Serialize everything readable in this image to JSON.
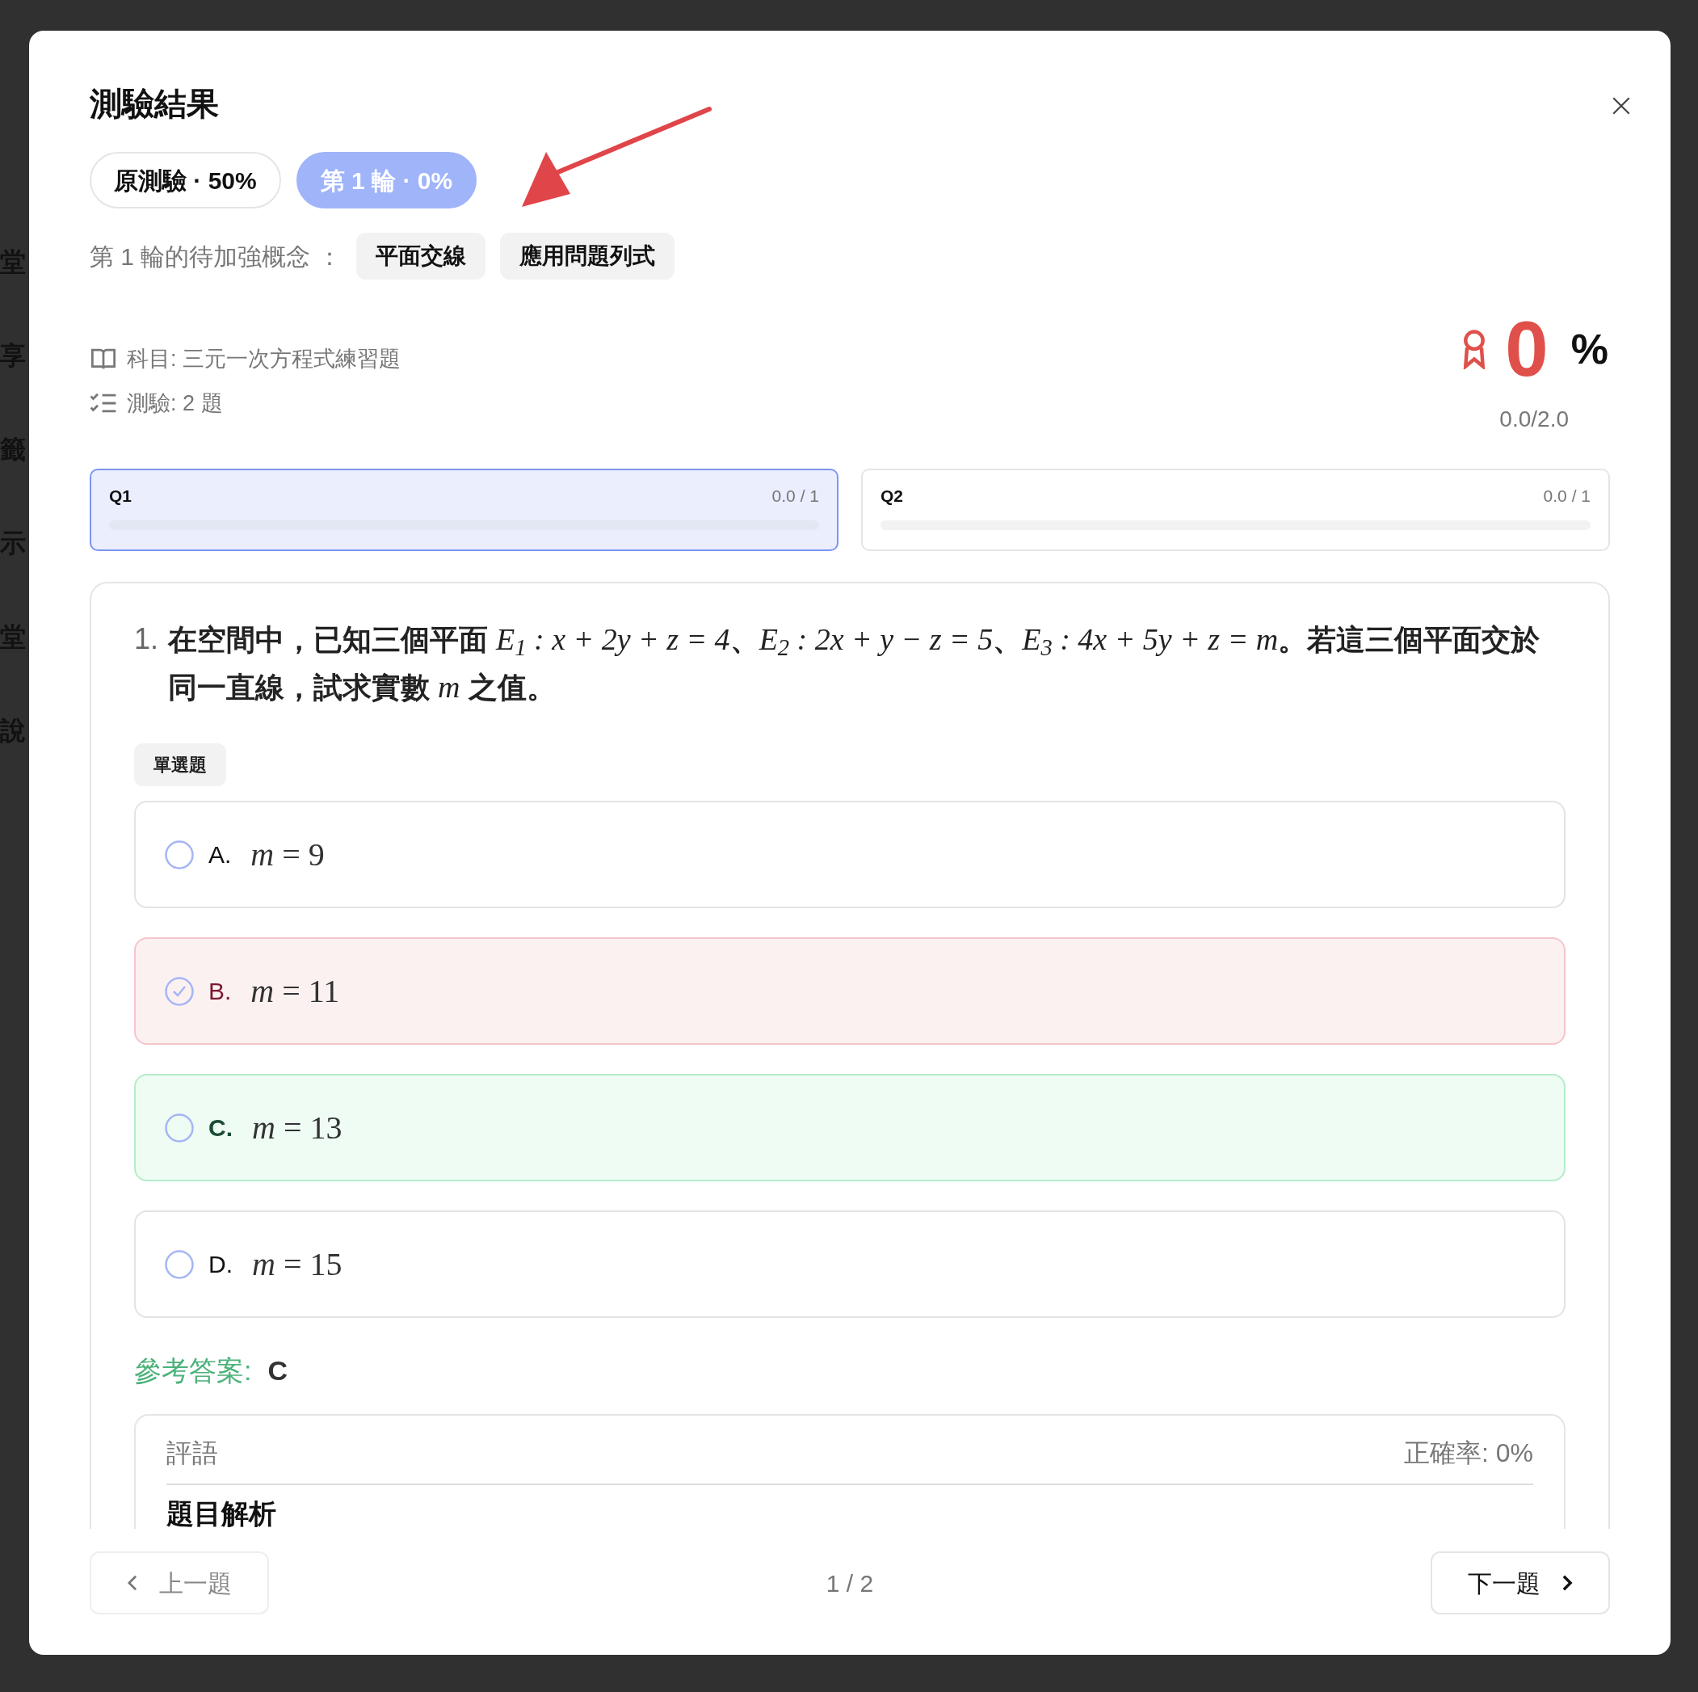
{
  "background_sidebar": [
    "堂",
    "享",
    "籤",
    "示",
    "堂",
    "說"
  ],
  "dialog": {
    "title": "測驗結果",
    "rounds": [
      {
        "label": "原測驗 · 50%",
        "selected": false
      },
      {
        "label": "第 1 輪 · 0%",
        "selected": true
      }
    ],
    "concepts_label": "第 1 輪的待加強概念 ：",
    "concepts": [
      "平面交線",
      "應用問題列式"
    ],
    "subject": "科目: 三元一次方程式練習題",
    "quiz": "測驗: 2 題",
    "score": {
      "value": "0",
      "unit": "%",
      "points": "0.0/2.0"
    },
    "questions": [
      {
        "label": "Q1",
        "score": "0.0 / 1",
        "level": 0,
        "selected": true
      },
      {
        "label": "Q2",
        "score": "0.0 / 1",
        "level": 0,
        "selected": false
      }
    ],
    "question": {
      "number": "1.",
      "text": [
        {
          "kind": "text",
          "text": "在空間中，已知三個平面 "
        },
        {
          "kind": "math",
          "text": "E$_{1}$ : x + 2y + z = 4"
        },
        {
          "kind": "text",
          "text": "、"
        },
        {
          "kind": "math",
          "text": "E$_{2}$ : 2x + y − z = 5"
        },
        {
          "kind": "text",
          "text": "、"
        },
        {
          "kind": "math",
          "text": "E$_{3}$ : 4x + 5y + z = m"
        },
        {
          "kind": "text",
          "text": "。若這三個平面交於同一直線，試求實數 "
        },
        {
          "kind": "math",
          "text": "m"
        },
        {
          "kind": "text",
          "text": " 之值。"
        }
      ],
      "type_tag": "單選題",
      "options": [
        {
          "letter": "A.",
          "value": "*m* = 9",
          "selected": false,
          "kind": "neutral"
        },
        {
          "letter": "B.",
          "value": "*m* = 11",
          "selected": true,
          "kind": "incorrect"
        },
        {
          "letter": "C.",
          "value": "*m* = 13",
          "selected": false,
          "kind": "correct"
        },
        {
          "letter": "D.",
          "value": "*m* = 15",
          "selected": false,
          "kind": "neutral"
        }
      ],
      "answer_label": "參考答案:",
      "answer": "C",
      "comment_label": "評語",
      "accuracy": "正確率: 0%",
      "analysis_heading": "題目解析"
    },
    "prev": "上一題",
    "page": "1 / 2",
    "next": "下一題"
  }
}
